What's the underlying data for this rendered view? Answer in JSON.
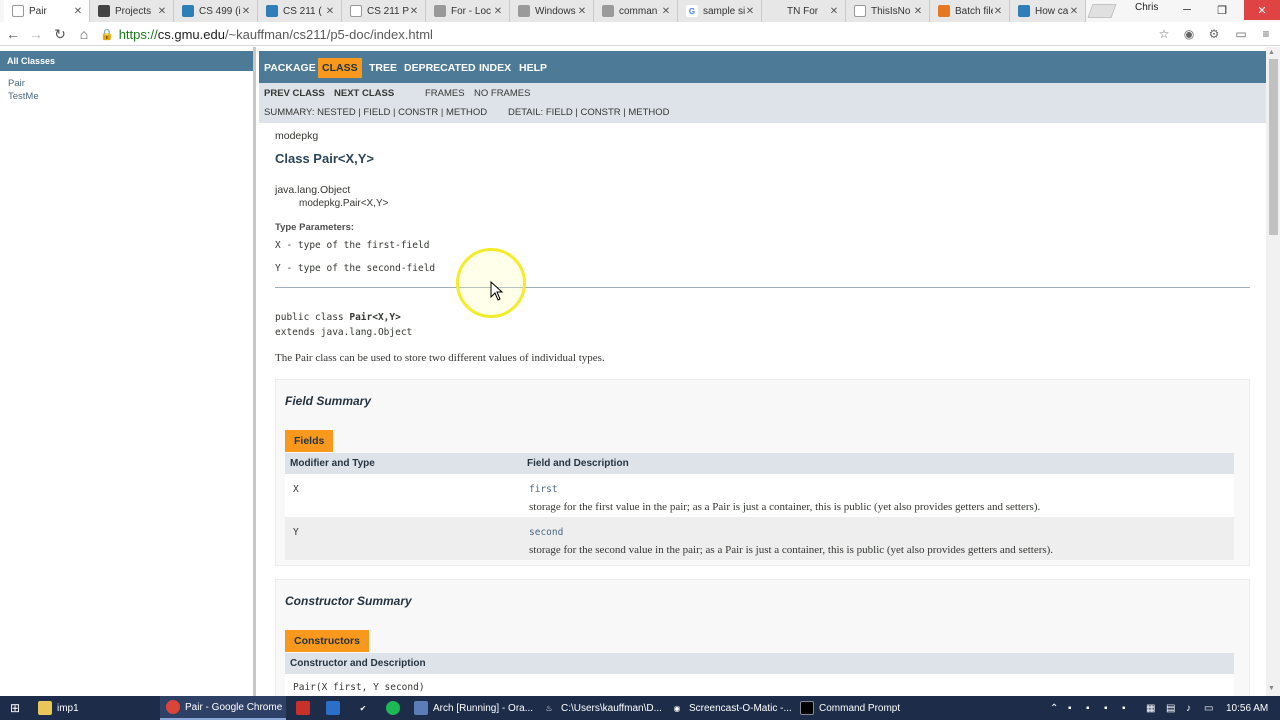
{
  "browser": {
    "tabs": [
      {
        "label": "Pair",
        "icon": "document-icon",
        "active": true
      },
      {
        "label": "Projects",
        "icon": "project-icon"
      },
      {
        "label": "CS 499 (i",
        "icon": "page-icon"
      },
      {
        "label": "CS 211 (",
        "icon": "page-icon"
      },
      {
        "label": "CS 211 P",
        "icon": "document-icon"
      },
      {
        "label": "For - Loc",
        "icon": "folder-icon"
      },
      {
        "label": "Windows",
        "icon": "link-icon"
      },
      {
        "label": "comman",
        "icon": "link-icon"
      },
      {
        "label": "sample si",
        "icon": "google-icon"
      },
      {
        "label": "TN For",
        "icon": "blank-icon"
      },
      {
        "label": "ThisIsNo",
        "icon": "document-icon"
      },
      {
        "label": "Batch file",
        "icon": "stack-icon"
      },
      {
        "label": "How can",
        "icon": "page-icon"
      }
    ],
    "user": "Chris",
    "url_scheme": "https://",
    "url_host": "cs.gmu.edu",
    "url_path": "/~kauffman/cs211/p5-doc/index.html"
  },
  "left_frame": {
    "header": "All Classes",
    "classes": [
      "Pair",
      "TestMe"
    ]
  },
  "javadoc": {
    "top_nav": [
      "PACKAGE",
      "CLASS",
      "TREE",
      "DEPRECATED",
      "INDEX",
      "HELP"
    ],
    "selected_nav": "CLASS",
    "prev_class": "PREV CLASS",
    "next_class": "NEXT CLASS",
    "frames": "FRAMES",
    "no_frames": "NO FRAMES",
    "summary_line": "SUMMARY: NESTED | FIELD | CONSTR | METHOD",
    "detail_line": "DETAIL: FIELD | CONSTR | METHOD",
    "package": "modepkg",
    "class_title": "Class Pair<X,Y>",
    "inheritance_parent": "java.lang.Object",
    "inheritance_child": "modepkg.Pair<X,Y>",
    "type_params_heading": "Type Parameters:",
    "type_params": [
      "X - type of the first-field",
      "Y - type of the second-field"
    ],
    "declaration_prefix": "public class ",
    "declaration_name": "Pair<X,Y>",
    "declaration_extends": "extends java.lang.Object",
    "description": "The Pair class can be used to store two different values of individual types.",
    "field_summary": {
      "title": "Field Summary",
      "caption": "Fields",
      "col1": "Modifier and Type",
      "col2": "Field and Description",
      "rows": [
        {
          "type": "X",
          "name": "first",
          "desc": "storage for the first value in the pair; as a Pair is just a container, this is public (yet also provides getters and setters)."
        },
        {
          "type": "Y",
          "name": "second",
          "desc": "storage for the second value in the pair; as a Pair is just a container, this is public (yet also provides getters and setters)."
        }
      ]
    },
    "constructor_summary": {
      "title": "Constructor Summary",
      "caption": "Constructors",
      "col1": "Constructor and Description",
      "rows": [
        {
          "signature": "Pair(X first, Y second)"
        }
      ]
    }
  },
  "taskbar": {
    "items": [
      {
        "label": "imp1",
        "icon": "folder-icon"
      },
      {
        "label": "Pair - Google Chrome",
        "icon": "chrome-icon"
      },
      {
        "label": "",
        "icon": "mail-icon"
      },
      {
        "label": "",
        "icon": "text-icon"
      },
      {
        "label": "",
        "icon": "check-icon"
      },
      {
        "label": "",
        "icon": "music-icon"
      },
      {
        "label": "Arch [Running] - Ora...",
        "icon": "virtualbox-icon"
      },
      {
        "label": "C:\\Users\\kauffman\\D...",
        "icon": "java-icon"
      },
      {
        "label": "Screencast-O-Matic -...",
        "icon": "record-icon"
      },
      {
        "label": "Command Prompt",
        "icon": "terminal-icon"
      }
    ],
    "time": "10:56 AM"
  }
}
